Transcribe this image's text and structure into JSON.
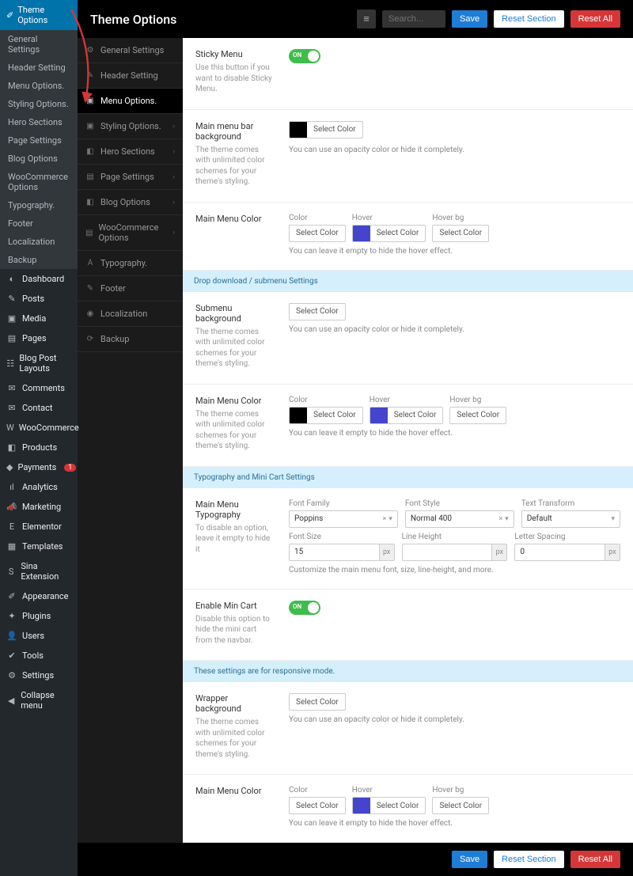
{
  "wp_sidebar": {
    "active_top": "Theme Options",
    "sub": [
      "General Settings",
      "Header Setting",
      "Menu Options.",
      "Styling Options.",
      "Hero Sections",
      "Page Settings",
      "Blog Options",
      "WooCommerce Options",
      "Typography.",
      "Footer",
      "Localization",
      "Backup"
    ],
    "items": [
      {
        "icon": "◐",
        "label": "Dashboard"
      },
      {
        "icon": "✎",
        "label": "Posts"
      },
      {
        "icon": "▣",
        "label": "Media"
      },
      {
        "icon": "▤",
        "label": "Pages"
      },
      {
        "icon": "☷",
        "label": "Blog Post Layouts"
      },
      {
        "icon": "✉",
        "label": "Comments"
      },
      {
        "icon": "✉",
        "label": "Contact"
      },
      {
        "icon": "W",
        "label": "WooCommerce"
      },
      {
        "icon": "◧",
        "label": "Products"
      },
      {
        "icon": "◆",
        "label": "Payments",
        "badge": "1"
      },
      {
        "icon": "ıl",
        "label": "Analytics"
      },
      {
        "icon": "📣",
        "label": "Marketing"
      },
      {
        "icon": "E",
        "label": "Elementor"
      },
      {
        "icon": "▦",
        "label": "Templates"
      },
      {
        "icon": "S",
        "label": "Sina Extension"
      },
      {
        "icon": "✐",
        "label": "Appearance"
      },
      {
        "icon": "✦",
        "label": "Plugins"
      },
      {
        "icon": "👤",
        "label": "Users"
      },
      {
        "icon": "✔",
        "label": "Tools"
      },
      {
        "icon": "⚙",
        "label": "Settings"
      },
      {
        "icon": "◀",
        "label": "Collapse menu"
      }
    ]
  },
  "topbar": {
    "title": "Theme Options",
    "search_placeholder": "Search...",
    "save": "Save",
    "reset_section": "Reset Section",
    "reset_all": "Reset All"
  },
  "panel_nav": [
    {
      "icon": "⚙",
      "label": "General Settings"
    },
    {
      "icon": "✎",
      "label": "Header Setting"
    },
    {
      "icon": "▣",
      "label": "Menu Options.",
      "active": true
    },
    {
      "icon": "▣",
      "label": "Styling Options.",
      "chev": true
    },
    {
      "icon": "◧",
      "label": "Hero Sections",
      "chev": true
    },
    {
      "icon": "▤",
      "label": "Page Settings",
      "chev": true
    },
    {
      "icon": "◧",
      "label": "Blog Options",
      "chev": true
    },
    {
      "icon": "▤",
      "label": "WooCommerce Options",
      "chev": true
    },
    {
      "icon": "A",
      "label": "Typography."
    },
    {
      "icon": "✎",
      "label": "Footer"
    },
    {
      "icon": "◉",
      "label": "Localization"
    },
    {
      "icon": "⟳",
      "label": "Backup"
    }
  ],
  "sections": {
    "sticky": {
      "title": "Sticky Menu",
      "desc": "Use this button if you want to disable Sticky Menu.",
      "on": "ON"
    },
    "menubar_bg": {
      "title": "Main menu bar background",
      "desc": "The theme comes with unlimited color schemes for your theme's styling.",
      "hint": "You can use an opacity color or hide it completely.",
      "select": "Select Color",
      "swatch": "#000000"
    },
    "menu_color": {
      "title": "Main Menu Color",
      "labels": [
        "Color",
        "Hover",
        "Hover bg"
      ],
      "swatch_hover": "#4444cc",
      "select": "Select Color",
      "hint": "You can leave it empty to hide the hover effect."
    },
    "band1": "Drop download / submenu Settings",
    "submenu_bg": {
      "title": "Submenu background",
      "desc": "The theme comes with unlimited color schemes for your theme's styling.",
      "hint": "You can use an opacity color or hide it completely.",
      "select": "Select Color"
    },
    "menu_color2": {
      "title": "Main Menu Color",
      "desc": "The theme comes with unlimited color schemes for your theme's styling.",
      "labels": [
        "Color",
        "Hover",
        "Hover bg"
      ],
      "swatch": "#000000",
      "swatch_hover": "#4444cc",
      "select": "Select Color",
      "hint": "You can leave it empty to hide the hover effect."
    },
    "band2": "Typography and Mini Cart Settings",
    "typo": {
      "title": "Main Menu Typography",
      "desc": "To disable an option, leave it empty to hide it",
      "font_family_lab": "Font Family",
      "font_family": "Poppins",
      "font_style_lab": "Font Style",
      "font_style": "Normal 400",
      "text_transform_lab": "Text Transform",
      "text_transform": "Default",
      "font_size_lab": "Font Size",
      "font_size": "15",
      "line_height_lab": "Line Height",
      "line_height": "",
      "letter_spacing_lab": "Letter Spacing",
      "letter_spacing": "0",
      "unit": "px",
      "hint": "Customize the main menu font, size, line-height, and more."
    },
    "mincart": {
      "title": "Enable Min Cart",
      "desc": "Disable this option to hide the mini cart from the navbar.",
      "on": "ON"
    },
    "band3": "These settings are for responsive mode.",
    "wrapper_bg": {
      "title": "Wrapper background",
      "desc": "The theme comes with unlimited color schemes for your theme's styling.",
      "hint": "You can use an opacity color or hide it completely.",
      "select": "Select Color"
    },
    "menu_color3": {
      "title": "Main Menu Color",
      "labels": [
        "Color",
        "Hover",
        "Hover bg"
      ],
      "swatch_hover": "#4444cc",
      "select": "Select Color",
      "hint": "You can leave it empty to hide the hover effect."
    }
  },
  "footer": {
    "save": "Save",
    "reset_section": "Reset Section",
    "reset_all": "Reset All"
  }
}
